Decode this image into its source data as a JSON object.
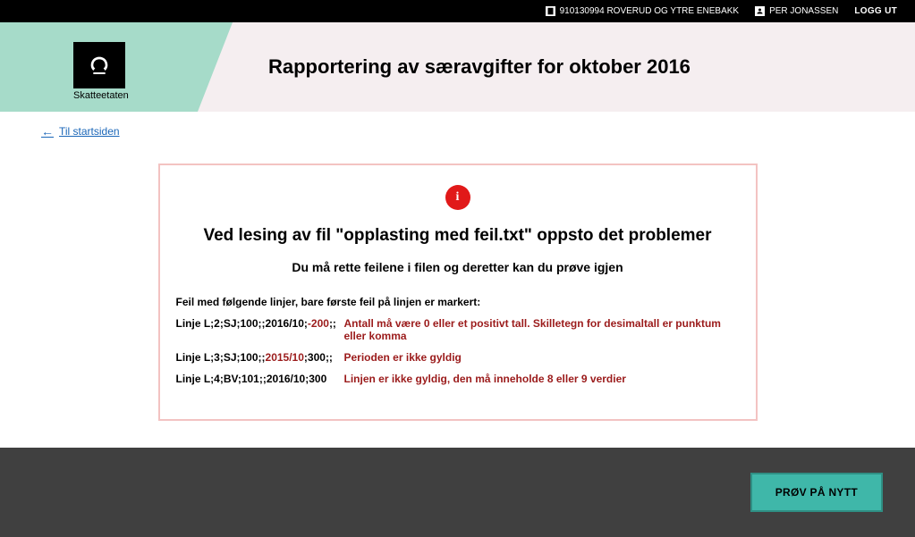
{
  "topbar": {
    "org": "910130994 ROVERUD OG YTRE ENEBAKK",
    "user": "PER JONASSEN",
    "logout": "LOGG UT"
  },
  "header": {
    "brand": "Skatteetaten",
    "title": "Rapportering av særavgifter for oktober 2016"
  },
  "nav": {
    "back": "Til startsiden"
  },
  "error": {
    "title": "Ved lesing av fil \"opplasting med feil.txt\" oppsto det problemer",
    "subtitle": "Du må rette feilene i filen og deretter kan du prøve igjen",
    "intro": "Feil med følgende linjer, bare første feil på linjen er markert:",
    "rows": [
      {
        "line_pre": "Linje L;2;SJ;100;;2016/10;",
        "line_hl": "-200",
        "line_post": ";;",
        "msg": "Antall må være 0 eller et positivt tall. Skilletegn for desimaltall er punktum eller komma"
      },
      {
        "line_pre": "Linje L;3;SJ;100;;",
        "line_hl": "2015/10",
        "line_post": ";300;;",
        "msg": "Perioden er ikke gyldig"
      },
      {
        "line_pre": "Linje L;4;BV;101;;2016/10;300",
        "line_hl": "",
        "line_post": "",
        "msg": "Linjen er ikke gyldig, den må inneholde 8 eller 9 verdier"
      }
    ]
  },
  "footer": {
    "retry": "PRØV PÅ NYTT"
  }
}
